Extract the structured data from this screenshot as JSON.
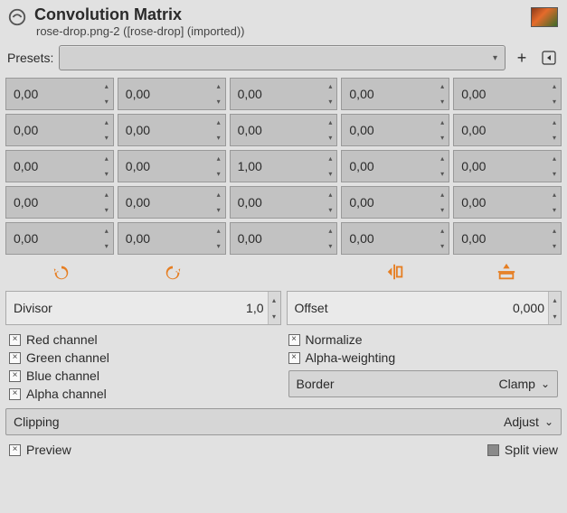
{
  "header": {
    "title": "Convolution Matrix",
    "subtitle": "rose-drop.png-2 ([rose-drop] (imported))"
  },
  "presets": {
    "label": "Presets:",
    "value": ""
  },
  "matrix": [
    [
      "0,00",
      "0,00",
      "0,00",
      "0,00",
      "0,00"
    ],
    [
      "0,00",
      "0,00",
      "0,00",
      "0,00",
      "0,00"
    ],
    [
      "0,00",
      "0,00",
      "1,00",
      "0,00",
      "0,00"
    ],
    [
      "0,00",
      "0,00",
      "0,00",
      "0,00",
      "0,00"
    ],
    [
      "0,00",
      "0,00",
      "0,00",
      "0,00",
      "0,00"
    ]
  ],
  "divisor": {
    "label": "Divisor",
    "value": "1,0"
  },
  "offset": {
    "label": "Offset",
    "value": "0,000"
  },
  "channels": {
    "red": "Red channel",
    "green": "Green channel",
    "blue": "Blue channel",
    "alpha": "Alpha channel"
  },
  "normalize": "Normalize",
  "alpha_weighting": "Alpha-weighting",
  "border": {
    "label": "Border",
    "value": "Clamp"
  },
  "clipping": {
    "label": "Clipping",
    "value": "Adjust"
  },
  "preview": "Preview",
  "split_view": "Split view"
}
